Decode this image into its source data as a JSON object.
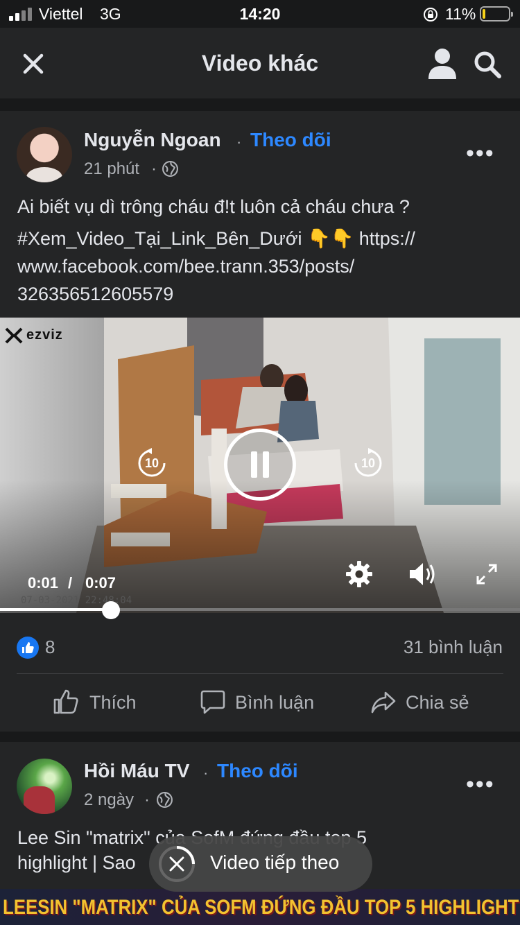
{
  "status_bar": {
    "carrier": "Viettel",
    "network": "3G",
    "time": "14:20",
    "battery_percent": "11%",
    "battery_level": 0.11
  },
  "header": {
    "title": "Video khác",
    "close_icon": "close-icon",
    "profile_icon": "person-icon",
    "search_icon": "search-icon"
  },
  "post1": {
    "author": "Nguyễn Ngoan",
    "follow_label": "Theo dõi",
    "time": "21 phút",
    "separator": "·",
    "privacy_icon": "globe-icon",
    "text_lines": [
      "Ai biết vụ dì trông cháu đ!t luôn cả cháu chưa ?",
      "#Xem_Video_Tại_Link_Bên_Dưới 👇👇   https://",
      "www.facebook.com/bee.trann.353/posts/",
      "326356512605579"
    ],
    "video": {
      "watermark": "ezviz",
      "cam_timestamp": "07-03-2021 22:48:04",
      "current_time": "0:01",
      "time_separator": "/",
      "duration": "0:07",
      "progress": 0.143,
      "rewind_seconds": "10",
      "forward_seconds": "10"
    },
    "reactions_count": "8",
    "comments_count": "31 bình luận",
    "actions": {
      "like": "Thích",
      "comment": "Bình luận",
      "share": "Chia sẻ"
    }
  },
  "post2": {
    "author": "Hồi Máu TV",
    "follow_label": "Theo dõi",
    "time": "2 ngày",
    "separator": "·",
    "text_line1": "Lee Sin \"matrix\" của SofM đứng đầu top 5",
    "text_line2": "highlight | Sao",
    "banner_text": "LEESIN \"MATRIX\" CỦA SOFM ĐỨNG ĐẦU TOP 5 HIGHLIGHT"
  },
  "next_video": {
    "label": "Video tiếp theo"
  },
  "colors": {
    "background": "#18191a",
    "card": "#242526",
    "accent": "#2d88ff",
    "text_primary": "#e4e6eb",
    "text_secondary": "#b0b3b8",
    "banner_text": "#f2c230"
  }
}
